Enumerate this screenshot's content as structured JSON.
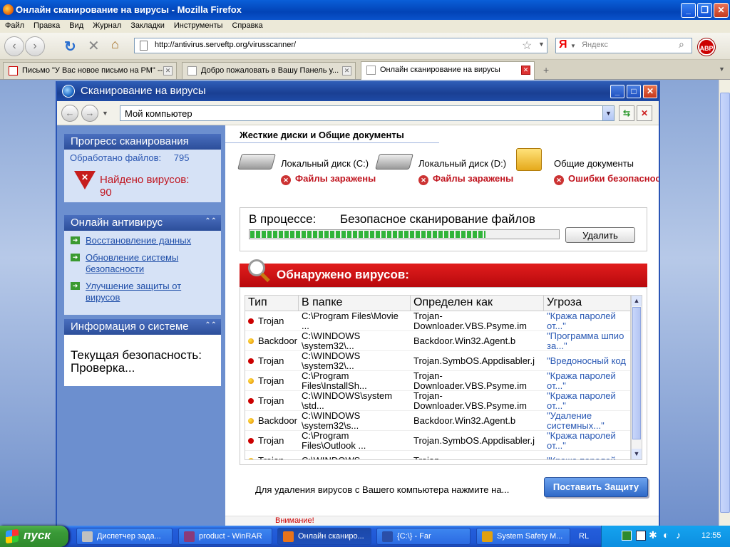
{
  "browser": {
    "title": "Онлайн сканирование на вирусы - Mozilla Firefox",
    "menu": [
      "Файл",
      "Правка",
      "Вид",
      "Журнал",
      "Закладки",
      "Инструменты",
      "Справка"
    ],
    "url": "http://antivirus.serveftp.org/virusscanner/",
    "search_placeholder": "Яндекс",
    "search_logo": "Я",
    "abp": "ABP",
    "tabs": [
      {
        "label": "Письмо \"У Вас новое письмо на РМ\" --..."
      },
      {
        "label": "Добро пожаловать в Вашу Панель у..."
      },
      {
        "label": "Онлайн сканирование на вирусы"
      }
    ]
  },
  "scanner": {
    "title": "Сканирование на вирусы",
    "location": "Мой компьютер",
    "progress_panel": {
      "header": "Прогресс сканирования",
      "files_label": "Обработано файлов:",
      "files_count": "795",
      "viruses_label": "Найдено вирусов:",
      "viruses_count": "90"
    },
    "antivirus_panel": {
      "header": "Онлайн антивирус",
      "links": [
        "Восстановление данных",
        "Обновление системы безопасности",
        "Улучшение защиты от вирусов"
      ]
    },
    "info_panel": {
      "header": "Информация о системе",
      "text": "Текущая безопасность: Проверка..."
    },
    "section_title": "Жесткие диски и Общие документы",
    "drives": [
      {
        "label": "Локальный диск (C:)",
        "status": "Файлы заражены",
        "icon": "hdd-icon"
      },
      {
        "label": "Локальный диск (D:)",
        "status": "Файлы заражены",
        "icon": "hdd-icon"
      },
      {
        "label": "Общие документы",
        "status": "Ошибки безопасности",
        "icon": "folder-icon"
      }
    ],
    "progress": {
      "label": "В процессе:",
      "task": "Безопасное сканирование файлов",
      "fraction": 0.76,
      "delete_button": "Удалить"
    },
    "viruses_header": "Обнаружено вирусов:",
    "table": {
      "headers": [
        "Тип",
        "В папке",
        "Определен как",
        "Угроза"
      ],
      "rows": [
        {
          "type": "Trojan",
          "dot": "red",
          "path": [
            "C:\\Program Files\\Movie",
            "..."
          ],
          "name": [
            "Trojan-",
            "Downloader.VBS.Psyme.im"
          ],
          "threat": [
            "\"Кража паролей",
            "от...\""
          ]
        },
        {
          "type": "Backdoor",
          "dot": "orange",
          "path": [
            "C:\\WINDOWS",
            "\\system32\\..."
          ],
          "name": [
            "Backdoor.Win32.Agent.b",
            ""
          ],
          "threat": [
            "\"Программа шпио",
            "за...\""
          ]
        },
        {
          "type": "Trojan",
          "dot": "red",
          "path": [
            "C:\\WINDOWS",
            "\\system32\\..."
          ],
          "name": [
            "Trojan.SymbOS.Appdisabler.j",
            ""
          ],
          "threat": [
            "\"Вредоносный код",
            ""
          ]
        },
        {
          "type": "Trojan",
          "dot": "orange",
          "path": [
            "C:\\Program",
            "Files\\InstallSh..."
          ],
          "name": [
            "Trojan-",
            "Downloader.VBS.Psyme.im"
          ],
          "threat": [
            "\"Кража паролей",
            "от...\""
          ]
        },
        {
          "type": "Trojan",
          "dot": "red",
          "path": [
            "C:\\WINDOWS\\system",
            "\\std..."
          ],
          "name": [
            "Trojan-",
            "Downloader.VBS.Psyme.im"
          ],
          "threat": [
            "\"Кража паролей",
            "от...\""
          ]
        },
        {
          "type": "Backdoor",
          "dot": "orange",
          "path": [
            "C:\\WINDOWS",
            "\\system32\\s..."
          ],
          "name": [
            "Backdoor.Win32.Agent.b",
            ""
          ],
          "threat": [
            "\"Удаление",
            "системных...\""
          ]
        },
        {
          "type": "Trojan",
          "dot": "red",
          "path": [
            "C:\\Program",
            "Files\\Outlook ..."
          ],
          "name": [
            "Trojan.SymbOS.Appdisabler.j",
            ""
          ],
          "threat": [
            "\"Кража паролей",
            "от...\""
          ]
        },
        {
          "type": "Trojan",
          "dot": "orange",
          "path": [
            "C:\\WINDOWS",
            ""
          ],
          "name": [
            "Trojan-",
            ""
          ],
          "threat": [
            "\"Кража паролей",
            ""
          ]
        }
      ]
    },
    "bottom_text": "Для удаления вирусов с Вашего компьютера нажмите на...",
    "protect_button": "Поставить Защиту",
    "warning": "Внимание!"
  },
  "taskbar": {
    "start": "пуск",
    "items": [
      {
        "label": "Диспетчер зада...",
        "color": "#c0c0c0"
      },
      {
        "label": "product - WinRAR",
        "color": "#8a3a7a"
      },
      {
        "label": "Онлайн сканиро...",
        "color": "#e8731a"
      },
      {
        "label": "{C:\\} - Far",
        "color": "#2a4fa8"
      },
      {
        "label": "System Safety M...",
        "color": "#e0a010"
      }
    ],
    "lang": "RL",
    "clock": "12:55"
  }
}
